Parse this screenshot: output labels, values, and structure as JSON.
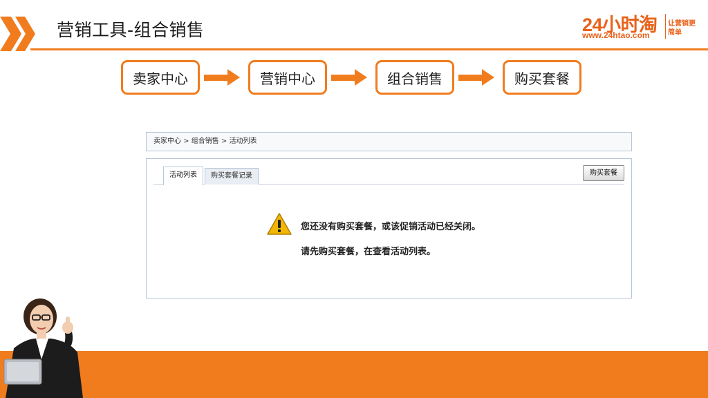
{
  "header": {
    "title": "营销工具-组合销售",
    "logo": {
      "main": "24小时淘",
      "url": "www.24htao.com",
      "slogan": "让营销更简单"
    }
  },
  "flow": {
    "steps": [
      "卖家中心",
      "营销中心",
      "组合销售",
      "购买套餐"
    ]
  },
  "app": {
    "breadcrumb": "卖家中心 > 组合销售 > 活动列表",
    "tabs": [
      "活动列表",
      "购买套餐记录"
    ],
    "buy_button": "购买套餐",
    "message_line1": "您还没有购买套餐，或该促销活动已经关闭。",
    "message_line2": "请先购买套餐，在查看活动列表。"
  },
  "colors": {
    "accent": "#f07c1e",
    "panel_border": "#b8c6d6",
    "warning": "#f2b705"
  }
}
